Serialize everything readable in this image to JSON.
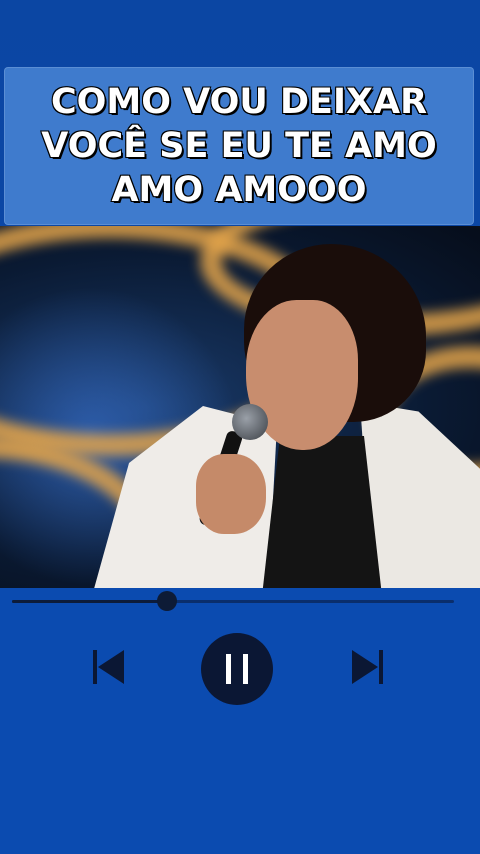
{
  "lyrics": {
    "line1": "COMO VOU DEIXAR",
    "line2": "VOCÊ SE EU TE AMO",
    "line3": "AMO AMOOO"
  },
  "player": {
    "progress": 0.35,
    "controls": {
      "previous_icon": "skip-previous-icon",
      "playpause_icon": "pause-icon",
      "next_icon": "skip-next-icon"
    }
  },
  "colors": {
    "background": "#0c4aa8",
    "lyrics_card": "#3f7bcd",
    "controls": "#0b1734"
  }
}
